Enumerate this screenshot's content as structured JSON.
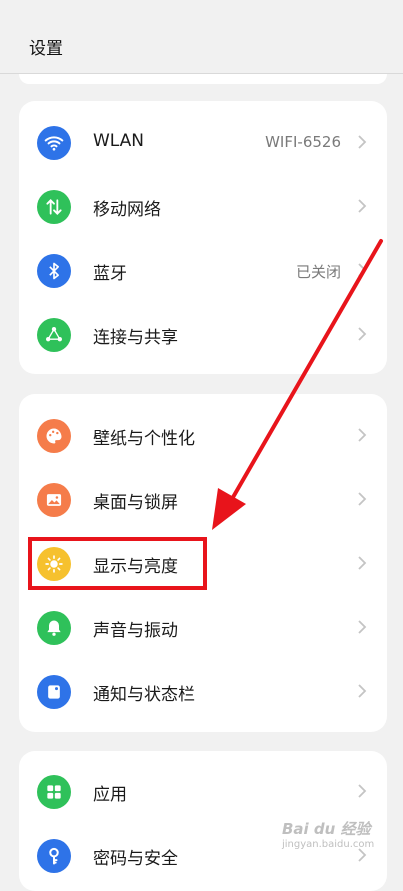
{
  "header": {
    "title": "设置"
  },
  "colors": {
    "blue": "#2e73e8",
    "green": "#2fc15a",
    "orange": "#f57c4a",
    "yellow": "#f6c12e",
    "annotation_red": "#e8141b"
  },
  "groups": [
    {
      "items": [
        {
          "label": "WLAN",
          "value": "WIFI-6526",
          "icon": "wifi-icon"
        },
        {
          "label": "移动网络",
          "value": "",
          "icon": "mobile-data-icon"
        },
        {
          "label": "蓝牙",
          "value": "已关闭",
          "icon": "bluetooth-icon"
        },
        {
          "label": "连接与共享",
          "value": "",
          "icon": "share-icon"
        }
      ]
    },
    {
      "items": [
        {
          "label": "壁纸与个性化",
          "value": "",
          "icon": "palette-icon"
        },
        {
          "label": "桌面与锁屏",
          "value": "",
          "icon": "image-icon"
        },
        {
          "label": "显示与亮度",
          "value": "",
          "icon": "sun-icon"
        },
        {
          "label": "声音与振动",
          "value": "",
          "icon": "bell-icon"
        },
        {
          "label": "通知与状态栏",
          "value": "",
          "icon": "notification-icon"
        }
      ]
    },
    {
      "items": [
        {
          "label": "应用",
          "value": "",
          "icon": "apps-icon"
        },
        {
          "label": "密码与安全",
          "value": "",
          "icon": "key-icon"
        }
      ]
    }
  ],
  "watermark": {
    "main": "Bai du 经验",
    "sub": "jingyan.baidu.com"
  }
}
